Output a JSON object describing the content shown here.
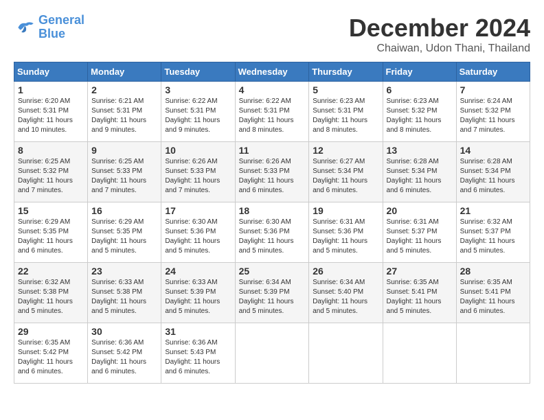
{
  "header": {
    "logo_line1": "General",
    "logo_line2": "Blue",
    "month_title": "December 2024",
    "location": "Chaiwan, Udon Thani, Thailand"
  },
  "days_of_week": [
    "Sunday",
    "Monday",
    "Tuesday",
    "Wednesday",
    "Thursday",
    "Friday",
    "Saturday"
  ],
  "weeks": [
    [
      {
        "day": "1",
        "sunrise": "6:20 AM",
        "sunset": "5:31 PM",
        "daylight": "11 hours and 10 minutes."
      },
      {
        "day": "2",
        "sunrise": "6:21 AM",
        "sunset": "5:31 PM",
        "daylight": "11 hours and 9 minutes."
      },
      {
        "day": "3",
        "sunrise": "6:22 AM",
        "sunset": "5:31 PM",
        "daylight": "11 hours and 9 minutes."
      },
      {
        "day": "4",
        "sunrise": "6:22 AM",
        "sunset": "5:31 PM",
        "daylight": "11 hours and 8 minutes."
      },
      {
        "day": "5",
        "sunrise": "6:23 AM",
        "sunset": "5:31 PM",
        "daylight": "11 hours and 8 minutes."
      },
      {
        "day": "6",
        "sunrise": "6:23 AM",
        "sunset": "5:32 PM",
        "daylight": "11 hours and 8 minutes."
      },
      {
        "day": "7",
        "sunrise": "6:24 AM",
        "sunset": "5:32 PM",
        "daylight": "11 hours and 7 minutes."
      }
    ],
    [
      {
        "day": "8",
        "sunrise": "6:25 AM",
        "sunset": "5:32 PM",
        "daylight": "11 hours and 7 minutes."
      },
      {
        "day": "9",
        "sunrise": "6:25 AM",
        "sunset": "5:33 PM",
        "daylight": "11 hours and 7 minutes."
      },
      {
        "day": "10",
        "sunrise": "6:26 AM",
        "sunset": "5:33 PM",
        "daylight": "11 hours and 7 minutes."
      },
      {
        "day": "11",
        "sunrise": "6:26 AM",
        "sunset": "5:33 PM",
        "daylight": "11 hours and 6 minutes."
      },
      {
        "day": "12",
        "sunrise": "6:27 AM",
        "sunset": "5:34 PM",
        "daylight": "11 hours and 6 minutes."
      },
      {
        "day": "13",
        "sunrise": "6:28 AM",
        "sunset": "5:34 PM",
        "daylight": "11 hours and 6 minutes."
      },
      {
        "day": "14",
        "sunrise": "6:28 AM",
        "sunset": "5:34 PM",
        "daylight": "11 hours and 6 minutes."
      }
    ],
    [
      {
        "day": "15",
        "sunrise": "6:29 AM",
        "sunset": "5:35 PM",
        "daylight": "11 hours and 6 minutes."
      },
      {
        "day": "16",
        "sunrise": "6:29 AM",
        "sunset": "5:35 PM",
        "daylight": "11 hours and 5 minutes."
      },
      {
        "day": "17",
        "sunrise": "6:30 AM",
        "sunset": "5:36 PM",
        "daylight": "11 hours and 5 minutes."
      },
      {
        "day": "18",
        "sunrise": "6:30 AM",
        "sunset": "5:36 PM",
        "daylight": "11 hours and 5 minutes."
      },
      {
        "day": "19",
        "sunrise": "6:31 AM",
        "sunset": "5:36 PM",
        "daylight": "11 hours and 5 minutes."
      },
      {
        "day": "20",
        "sunrise": "6:31 AM",
        "sunset": "5:37 PM",
        "daylight": "11 hours and 5 minutes."
      },
      {
        "day": "21",
        "sunrise": "6:32 AM",
        "sunset": "5:37 PM",
        "daylight": "11 hours and 5 minutes."
      }
    ],
    [
      {
        "day": "22",
        "sunrise": "6:32 AM",
        "sunset": "5:38 PM",
        "daylight": "11 hours and 5 minutes."
      },
      {
        "day": "23",
        "sunrise": "6:33 AM",
        "sunset": "5:38 PM",
        "daylight": "11 hours and 5 minutes."
      },
      {
        "day": "24",
        "sunrise": "6:33 AM",
        "sunset": "5:39 PM",
        "daylight": "11 hours and 5 minutes."
      },
      {
        "day": "25",
        "sunrise": "6:34 AM",
        "sunset": "5:39 PM",
        "daylight": "11 hours and 5 minutes."
      },
      {
        "day": "26",
        "sunrise": "6:34 AM",
        "sunset": "5:40 PM",
        "daylight": "11 hours and 5 minutes."
      },
      {
        "day": "27",
        "sunrise": "6:35 AM",
        "sunset": "5:41 PM",
        "daylight": "11 hours and 5 minutes."
      },
      {
        "day": "28",
        "sunrise": "6:35 AM",
        "sunset": "5:41 PM",
        "daylight": "11 hours and 6 minutes."
      }
    ],
    [
      {
        "day": "29",
        "sunrise": "6:35 AM",
        "sunset": "5:42 PM",
        "daylight": "11 hours and 6 minutes."
      },
      {
        "day": "30",
        "sunrise": "6:36 AM",
        "sunset": "5:42 PM",
        "daylight": "11 hours and 6 minutes."
      },
      {
        "day": "31",
        "sunrise": "6:36 AM",
        "sunset": "5:43 PM",
        "daylight": "11 hours and 6 minutes."
      },
      null,
      null,
      null,
      null
    ]
  ]
}
